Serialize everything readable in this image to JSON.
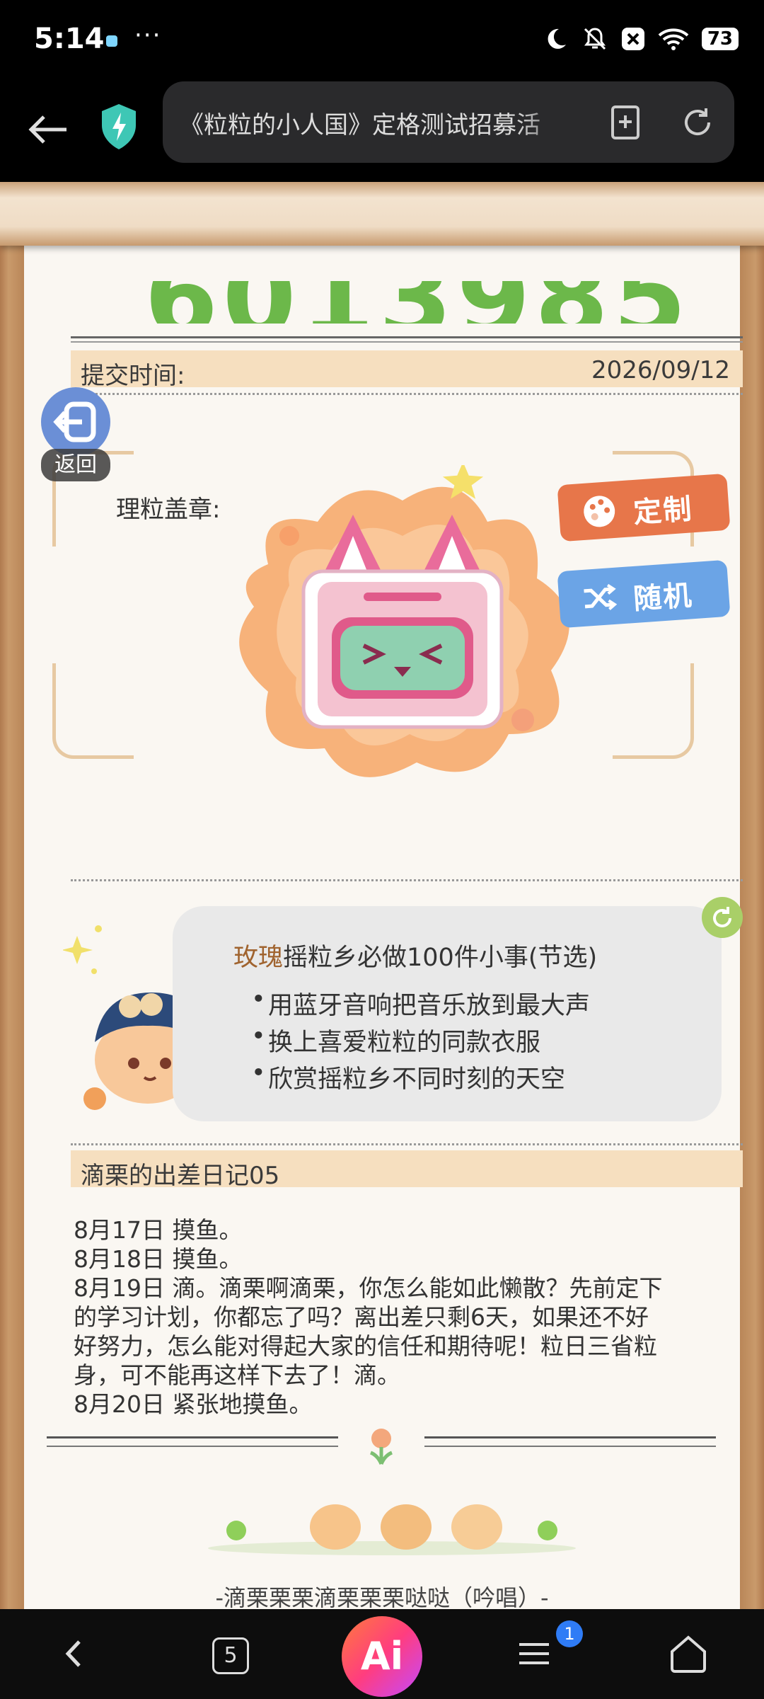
{
  "status": {
    "time": "5:14",
    "dots": "···",
    "battery": "73"
  },
  "browser": {
    "url_text": "《粒粒的小人国》定格测试招募活"
  },
  "page": {
    "big_number": "60139852",
    "submit_time": {
      "label": "提交时间:",
      "value": "2026/09/12"
    },
    "stamp_label": "理粒盖章:",
    "back_button_label": "返回",
    "customize_label": "定制",
    "random_label": "随机",
    "todo": {
      "prefix": "玫瑰",
      "title": "摇粒乡必做100件小事(节选)",
      "items": [
        "用蓝牙音响把音乐放到最大声",
        "换上喜爱粒粒的同款衣服",
        "欣赏摇粒乡不同时刻的天空"
      ]
    },
    "diary": {
      "title": "滴栗的出差日记05",
      "lines": [
        "8月17日  摸鱼。",
        "8月18日  摸鱼。",
        "8月19日  滴。滴栗啊滴栗，你怎么能如此懒散？先前定下",
        "的学习计划，你都忘了吗？离出差只剩6天，如果还不好",
        "好努力，怎么能对得起大家的信任和期待呢！粒日三省粒",
        "身，可不能再这样下去了！滴。",
        "8月20日  紧张地摸鱼。"
      ]
    },
    "song": "-滴栗栗栗滴栗栗栗哒哒（吟唱）-",
    "emoticon": "(^▽^)"
  },
  "navbar": {
    "tabs_count": "5",
    "ai_label": "Ai",
    "menu_badge": "1"
  }
}
